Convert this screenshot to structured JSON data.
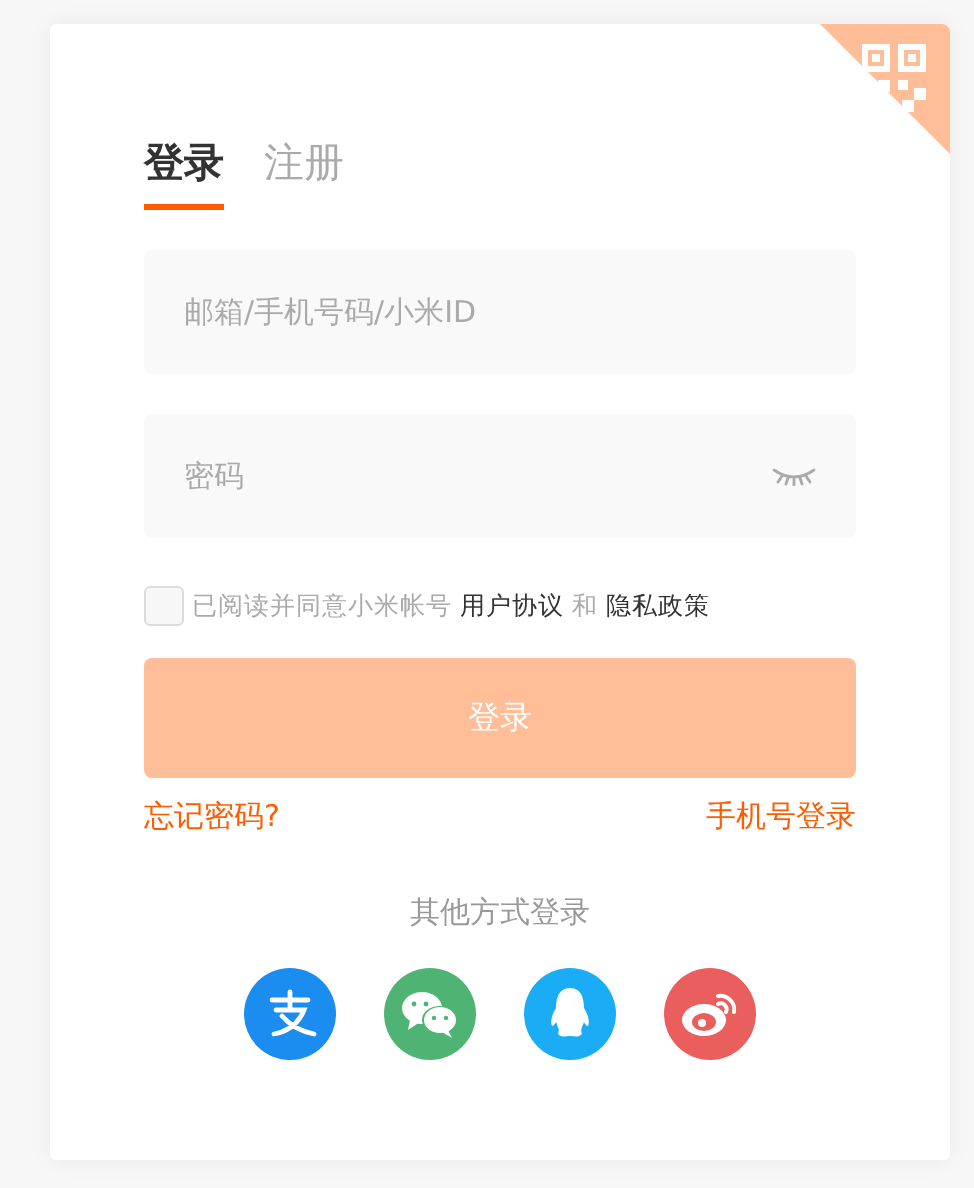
{
  "tabs": [
    {
      "label": "登录",
      "selected": true
    },
    {
      "label": "注册",
      "selected": false
    }
  ],
  "fields": [
    {
      "kind": "text",
      "placeholder": "邮箱/手机号码/小米ID"
    },
    {
      "kind": "password",
      "placeholder": "密码"
    }
  ],
  "agreement": {
    "checked": false,
    "text": "已阅读并同意小米帐号",
    "link_1": "用户协议",
    "conjunction": "和",
    "link_2": "隐私政策"
  },
  "login_button": {
    "label": "登录",
    "disabled": true
  },
  "forgot_link": "忘记密码?",
  "phone_login_link": "手机号登录",
  "other_login_title": "其他方式登录"
}
